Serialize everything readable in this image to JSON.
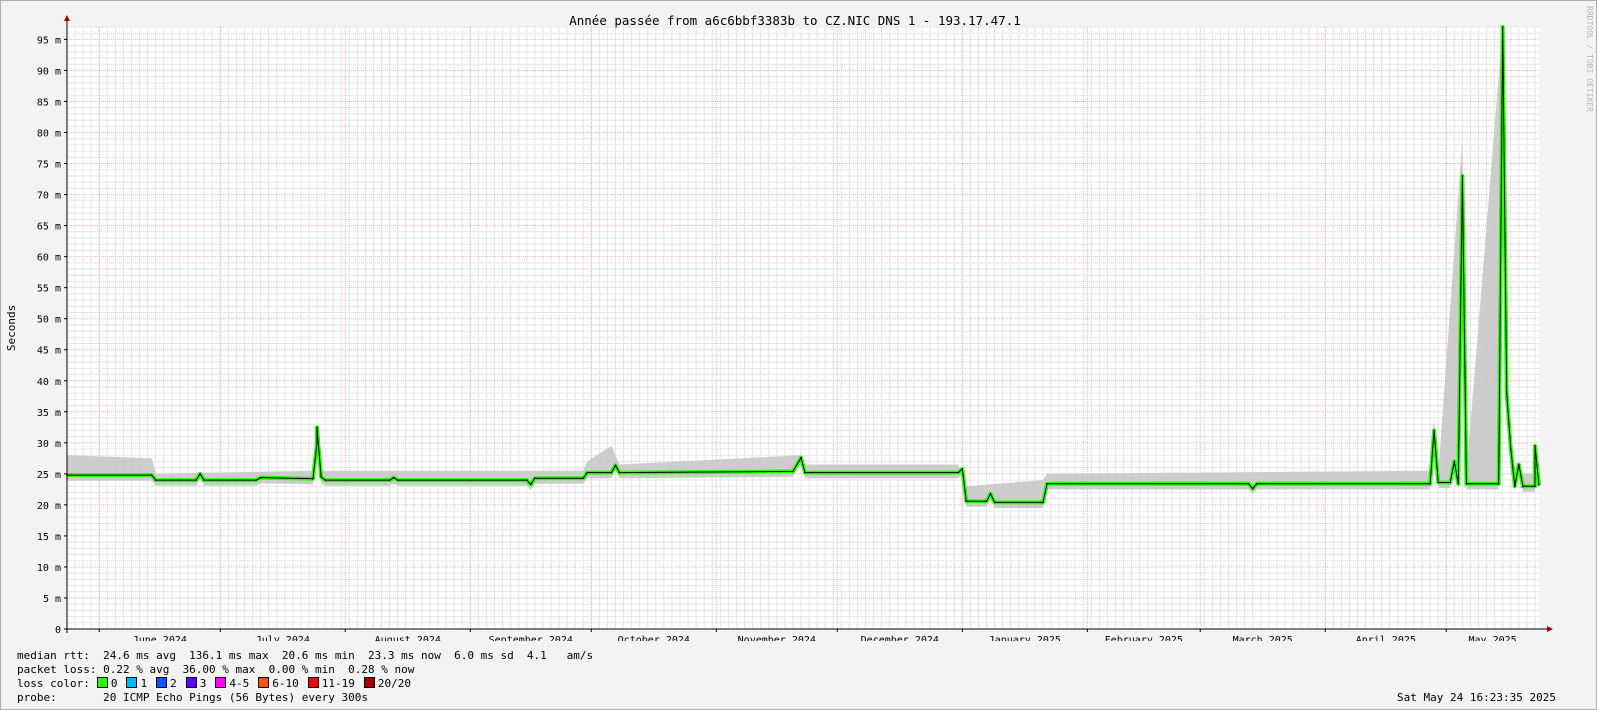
{
  "chart_data": {
    "type": "line",
    "title": "Année passée from a6c6bbf3383b to CZ.NIC DNS 1 - 193.17.47.1",
    "ylabel": "Seconds",
    "watermark": "RRDTOOL / TOBI OETIKER",
    "ylim": [
      0,
      97
    ],
    "y_ticks": [
      0,
      5,
      10,
      15,
      20,
      25,
      30,
      35,
      40,
      45,
      50,
      55,
      60,
      65,
      70,
      75,
      80,
      85,
      90,
      95
    ],
    "y_tick_labels": [
      "0",
      "5 m",
      "10 m",
      "15 m",
      "20 m",
      "25 m",
      "30 m",
      "35 m",
      "40 m",
      "45 m",
      "50 m",
      "55 m",
      "60 m",
      "65 m",
      "70 m",
      "75 m",
      "80 m",
      "85 m",
      "90 m",
      "95 m"
    ],
    "y_unit": "ms",
    "x_range": [
      "2024-05-24",
      "2025-05-24"
    ],
    "months": [
      {
        "label": "June 2024",
        "start": "2024-06-01"
      },
      {
        "label": "July 2024",
        "start": "2024-07-01"
      },
      {
        "label": "August 2024",
        "start": "2024-08-01"
      },
      {
        "label": "September 2024",
        "start": "2024-09-01"
      },
      {
        "label": "October 2024",
        "start": "2024-10-01"
      },
      {
        "label": "November 2024",
        "start": "2024-11-01"
      },
      {
        "label": "December 2024",
        "start": "2024-12-01"
      },
      {
        "label": "January 2025",
        "start": "2025-01-01"
      },
      {
        "label": "February 2025",
        "start": "2025-02-01"
      },
      {
        "label": "March 2025",
        "start": "2025-03-01"
      },
      {
        "label": "April 2025",
        "start": "2025-04-01"
      },
      {
        "label": "May 2025",
        "start": "2025-05-01"
      }
    ],
    "grid": true,
    "median_series": [
      {
        "x": "2024-05-24",
        "y": 24.8
      },
      {
        "x": "2024-06-14",
        "y": 24.8
      },
      {
        "x": "2024-06-15",
        "y": 24.0
      },
      {
        "x": "2024-06-25",
        "y": 24.0
      },
      {
        "x": "2024-06-26",
        "y": 25.0
      },
      {
        "x": "2024-06-27",
        "y": 24.0
      },
      {
        "x": "2024-07-10",
        "y": 24.0
      },
      {
        "x": "2024-07-11",
        "y": 24.4
      },
      {
        "x": "2024-07-24",
        "y": 24.2
      },
      {
        "x": "2024-07-25",
        "y": 30.0
      },
      {
        "x": "2024-07-25",
        "y": 32.5
      },
      {
        "x": "2024-07-26",
        "y": 24.5
      },
      {
        "x": "2024-07-27",
        "y": 24.0
      },
      {
        "x": "2024-08-12",
        "y": 24.0
      },
      {
        "x": "2024-08-13",
        "y": 24.4
      },
      {
        "x": "2024-08-14",
        "y": 24.0
      },
      {
        "x": "2024-09-15",
        "y": 24.0
      },
      {
        "x": "2024-09-16",
        "y": 23.3
      },
      {
        "x": "2024-09-17",
        "y": 24.3
      },
      {
        "x": "2024-09-29",
        "y": 24.3
      },
      {
        "x": "2024-09-30",
        "y": 25.2
      },
      {
        "x": "2024-10-06",
        "y": 25.2
      },
      {
        "x": "2024-10-07",
        "y": 26.4
      },
      {
        "x": "2024-10-08",
        "y": 25.2
      },
      {
        "x": "2024-11-20",
        "y": 25.4
      },
      {
        "x": "2024-11-22",
        "y": 27.6
      },
      {
        "x": "2024-11-23",
        "y": 25.2
      },
      {
        "x": "2024-12-31",
        "y": 25.2
      },
      {
        "x": "2025-01-01",
        "y": 25.8
      },
      {
        "x": "2025-01-02",
        "y": 20.6
      },
      {
        "x": "2025-01-07",
        "y": 20.6
      },
      {
        "x": "2025-01-08",
        "y": 21.8
      },
      {
        "x": "2025-01-09",
        "y": 20.4
      },
      {
        "x": "2025-01-21",
        "y": 20.4
      },
      {
        "x": "2025-01-22",
        "y": 23.4
      },
      {
        "x": "2025-03-13",
        "y": 23.4
      },
      {
        "x": "2025-03-14",
        "y": 22.6
      },
      {
        "x": "2025-03-15",
        "y": 23.4
      },
      {
        "x": "2025-04-27",
        "y": 23.4
      },
      {
        "x": "2025-04-28",
        "y": 32.0
      },
      {
        "x": "2025-04-29",
        "y": 23.6
      },
      {
        "x": "2025-05-02",
        "y": 23.6
      },
      {
        "x": "2025-05-03",
        "y": 27.0
      },
      {
        "x": "2025-05-04",
        "y": 23.4
      },
      {
        "x": "2025-05-05",
        "y": 73.0
      },
      {
        "x": "2025-05-06",
        "y": 23.4
      },
      {
        "x": "2025-05-14",
        "y": 23.4
      },
      {
        "x": "2025-05-15",
        "y": 97.0
      },
      {
        "x": "2025-05-16",
        "y": 38.0
      },
      {
        "x": "2025-05-17",
        "y": 29.0
      },
      {
        "x": "2025-05-18",
        "y": 23.0
      },
      {
        "x": "2025-05-19",
        "y": 26.5
      },
      {
        "x": "2025-05-20",
        "y": 23.0
      },
      {
        "x": "2025-05-23",
        "y": 23.0
      },
      {
        "x": "2025-05-23",
        "y": 29.5
      },
      {
        "x": "2025-05-24",
        "y": 23.2
      }
    ],
    "smoke_series": [
      {
        "x": "2024-05-24",
        "y": 28.0
      },
      {
        "x": "2024-06-14",
        "y": 27.5
      },
      {
        "x": "2024-06-15",
        "y": 25.0
      },
      {
        "x": "2024-07-24",
        "y": 25.5
      },
      {
        "x": "2024-07-25",
        "y": 33.0
      },
      {
        "x": "2024-07-26",
        "y": 25.5
      },
      {
        "x": "2024-09-29",
        "y": 25.5
      },
      {
        "x": "2024-09-30",
        "y": 27.0
      },
      {
        "x": "2024-10-06",
        "y": 29.5
      },
      {
        "x": "2024-10-08",
        "y": 26.5
      },
      {
        "x": "2024-11-22",
        "y": 28.0
      },
      {
        "x": "2024-11-23",
        "y": 26.5
      },
      {
        "x": "2024-12-31",
        "y": 26.5
      },
      {
        "x": "2025-01-02",
        "y": 23.0
      },
      {
        "x": "2025-01-21",
        "y": 24.0
      },
      {
        "x": "2025-01-22",
        "y": 25.0
      },
      {
        "x": "2025-04-27",
        "y": 25.5
      },
      {
        "x": "2025-04-28",
        "y": 34.0
      },
      {
        "x": "2025-04-29",
        "y": 25.0
      },
      {
        "x": "2025-05-05",
        "y": 79.0
      },
      {
        "x": "2025-05-06",
        "y": 25.0
      },
      {
        "x": "2025-05-15",
        "y": 97.0
      },
      {
        "x": "2025-05-16",
        "y": 40.0
      },
      {
        "x": "2025-05-17",
        "y": 25.0
      },
      {
        "x": "2025-05-24",
        "y": 25.0
      }
    ]
  },
  "footer": {
    "median_rtt_line": "median rtt:  24.6 ms avg  136.1 ms max  20.6 ms min  23.3 ms now  6.0 ms sd  4.1   am/s",
    "packet_loss_line": "packet loss: 0.22 % avg  36.00 % max  0.00 % min  0.28 % now",
    "loss_color_label": "loss color:",
    "loss_colors": [
      {
        "label": "0",
        "color": "#26ff00"
      },
      {
        "label": "1",
        "color": "#00b8ff"
      },
      {
        "label": "2",
        "color": "#0059ff"
      },
      {
        "label": "3",
        "color": "#5e00ff"
      },
      {
        "label": "4-5",
        "color": "#ff00ff"
      },
      {
        "label": "6-10",
        "color": "#ff5500"
      },
      {
        "label": "11-19",
        "color": "#ff0000"
      },
      {
        "label": "20/20",
        "color": "#a10000"
      }
    ],
    "probe_line": "probe:       20 ICMP Echo Pings (56 Bytes) every 300s",
    "timestamp": "Sat May 24 16:23:35 2025"
  },
  "colors": {
    "median": "#26ff00",
    "median_edge": "#000000",
    "smoke": "#c8c8c8",
    "minor_grid": "#e5e5e5",
    "major_grid": "#f2b5b5",
    "axis": "#000000",
    "arrow": "#a00000",
    "plot_bg": "#ffffff"
  }
}
